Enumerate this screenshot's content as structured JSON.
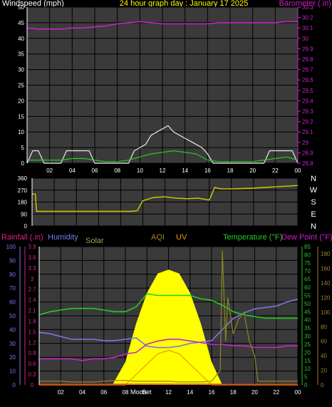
{
  "chart_data": [
    {
      "type": "line",
      "title": "24 hour graph day : January 17 2025",
      "left_axis_label": "Windspeed (mph)",
      "right_axis_label": "Barometer (.in)",
      "x_tick_labels": [
        "02",
        "04",
        "06",
        "08",
        "10",
        "12",
        "14",
        "16",
        "18",
        "20",
        "22",
        "00"
      ],
      "left_ticks": [
        0,
        5,
        10,
        15,
        20,
        25,
        30,
        35,
        40,
        45,
        50
      ],
      "right_ticks": [
        "28.8",
        "28.9",
        "29",
        "29.1",
        "29.2",
        "29.3",
        "29.4",
        "29.5",
        "29.6",
        "29.7",
        "29.8",
        "29.9",
        "30",
        "30.1",
        "30.2",
        "30.3"
      ],
      "ylim_left": [
        0,
        50
      ],
      "ylim_right": [
        28.8,
        30.3
      ],
      "series": [
        {
          "color": "#cc22cc",
          "axis": "right",
          "x": [
            0,
            1,
            2,
            3,
            4,
            5,
            6,
            7,
            8,
            9,
            10,
            11,
            12,
            13,
            14,
            15,
            16,
            17,
            18,
            19,
            20,
            21,
            22,
            23,
            24
          ],
          "y": [
            30.1,
            30.09,
            30.09,
            30.09,
            30.1,
            30.1,
            30.11,
            30.12,
            30.14,
            30.15,
            30.16,
            30.15,
            30.14,
            30.14,
            30.14,
            30.14,
            30.14,
            30.15,
            30.15,
            30.15,
            30.15,
            30.15,
            30.15,
            30.16,
            30.16
          ]
        },
        {
          "color": "#e8e8e8",
          "axis": "left",
          "x": [
            0,
            0.5,
            1,
            1.5,
            2,
            3,
            3.5,
            4,
            4.5,
            5,
            5.5,
            6,
            7,
            8,
            9,
            9.5,
            10,
            10.5,
            11,
            11.5,
            12,
            12.5,
            13,
            13.5,
            14,
            14.5,
            15,
            15.5,
            16,
            16.5,
            17,
            18,
            19,
            20,
            21,
            21.5,
            22,
            22.5,
            23,
            23.5,
            24
          ],
          "y": [
            0,
            4,
            4,
            0,
            0,
            0,
            4,
            4,
            4,
            4,
            4,
            0,
            0,
            0,
            0,
            4,
            5,
            6,
            9,
            10,
            11,
            12,
            10,
            9,
            8,
            7,
            6,
            5,
            3,
            0,
            0,
            0,
            0,
            0,
            0,
            4,
            4,
            4,
            4,
            4,
            0
          ]
        },
        {
          "color": "#22cc22",
          "axis": "left",
          "x": [
            0,
            1,
            2,
            3,
            4,
            5,
            6,
            7,
            8,
            9,
            10,
            11,
            12,
            13,
            14,
            15,
            16,
            17,
            18,
            19,
            20,
            21,
            22,
            23,
            24
          ],
          "y": [
            1,
            1,
            1,
            1,
            1.5,
            1.5,
            1,
            0.5,
            0.5,
            1,
            2,
            3,
            3.5,
            4,
            3.5,
            3,
            1,
            0.5,
            0.5,
            0.5,
            0.5,
            1,
            1.5,
            2,
            1
          ]
        }
      ]
    },
    {
      "type": "line",
      "title": "",
      "left_ticks": [
        0,
        90,
        180,
        270,
        360
      ],
      "right_ticks": [
        "N",
        "W",
        "S",
        "E",
        "N"
      ],
      "ylim": [
        0,
        360
      ],
      "series": [
        {
          "color": "#cccc00",
          "x": [
            0,
            0.3,
            0.4,
            1,
            2,
            3,
            4,
            5,
            6,
            7,
            8,
            9,
            9.5,
            10,
            11,
            12,
            13,
            14,
            15,
            16,
            16.5,
            17,
            18,
            19,
            20,
            21,
            22,
            23,
            24
          ],
          "y": [
            240,
            240,
            110,
            110,
            110,
            110,
            110,
            110,
            110,
            110,
            110,
            110,
            115,
            190,
            215,
            220,
            210,
            205,
            210,
            195,
            290,
            280,
            280,
            282,
            285,
            290,
            295,
            300,
            305
          ]
        }
      ]
    },
    {
      "type": "line",
      "title": "",
      "legend": [
        "Rainfall (.in)",
        "Humidity",
        "Solar",
        "AQI",
        "UV",
        "Temperature (°F)",
        "Dew Point (°F)"
      ],
      "rain_ticks": [
        "0",
        "0.3",
        "0.6",
        "0.9",
        "1.2",
        "1.5",
        "1.8",
        "2.1",
        "2.4",
        "2.7",
        "3",
        "3.3",
        "3.6",
        "3.9"
      ],
      "humidity_ticks": [
        0,
        10,
        20,
        30,
        40,
        50,
        60,
        70,
        80,
        90,
        100
      ],
      "temp_ticks": [
        0,
        5,
        10,
        15,
        20,
        25,
        30,
        35,
        40,
        45,
        50,
        55,
        60,
        65,
        70,
        75,
        80,
        85
      ],
      "aqi_ticks": [
        0,
        20,
        40,
        60,
        80,
        100,
        120,
        140,
        160,
        180
      ],
      "x_tick_labels": [
        "02",
        "04",
        "06",
        "08",
        "",
        "12",
        "14",
        "16",
        "18",
        "20",
        "22",
        "00"
      ],
      "moon_labels": [
        "Moon",
        "Set"
      ],
      "ylim_humidity": [
        0,
        100
      ],
      "ylim_temp": [
        0,
        85
      ],
      "ylim_aqi": [
        0,
        190
      ],
      "series": [
        {
          "name": "Humidity",
          "color": "#7777ee",
          "x": [
            0,
            1,
            2,
            3,
            4,
            5,
            6,
            7,
            8,
            9,
            10,
            11,
            12,
            13,
            14,
            15,
            16,
            17,
            18,
            19,
            20,
            21,
            22,
            23,
            24
          ],
          "y": [
            38,
            37,
            35,
            33,
            33,
            33,
            32,
            32,
            33,
            34,
            28,
            27,
            27,
            28,
            30,
            31,
            32,
            40,
            48,
            52,
            55,
            56,
            57,
            60,
            62
          ]
        },
        {
          "name": "Temperature (°F)",
          "color": "#22cc22",
          "x": [
            0,
            1,
            2,
            3,
            4,
            5,
            6,
            7,
            8,
            9,
            10,
            11,
            12,
            13,
            14,
            15,
            16,
            17,
            18,
            19,
            20,
            21,
            22,
            23,
            24
          ],
          "y": [
            43,
            45,
            46,
            47,
            47,
            47,
            46,
            45,
            45,
            48,
            56,
            55,
            55,
            55,
            55,
            53,
            52,
            49,
            45,
            43,
            42,
            41,
            41,
            41,
            41
          ]
        },
        {
          "name": "Dew Point (°F)",
          "color": "#cc22cc",
          "x": [
            0,
            1,
            2,
            3,
            4,
            5,
            6,
            7,
            8,
            9,
            10,
            11,
            12,
            13,
            14,
            15,
            16,
            17,
            18,
            19,
            20,
            21,
            22,
            23,
            24
          ],
          "y": [
            16,
            16,
            16,
            16,
            15,
            16,
            16,
            17,
            19,
            20,
            25,
            27,
            28,
            28,
            27,
            26,
            25,
            25,
            24,
            24,
            23,
            23,
            23,
            24,
            24
          ]
        },
        {
          "name": "Solar",
          "color": "#ffff00",
          "x": [
            0,
            6.8,
            8,
            9,
            10,
            11,
            12,
            13,
            14,
            15,
            16,
            17,
            17.2,
            24
          ],
          "y": [
            0,
            0,
            30,
            80,
            120,
            145,
            150,
            145,
            120,
            80,
            30,
            0,
            0,
            0
          ]
        },
        {
          "name": "AQI",
          "color": "#888820",
          "x": [
            0,
            1,
            2,
            3,
            4,
            5,
            6,
            7,
            8,
            9,
            10,
            11,
            12,
            13,
            14,
            15,
            16,
            16.8,
            17,
            17.3,
            17.5,
            18,
            18.5,
            19,
            19.5,
            20,
            20.3,
            21,
            22,
            23,
            24
          ],
          "y": [
            5,
            5,
            5,
            4,
            4,
            4,
            5,
            6,
            6,
            5,
            5,
            5,
            5,
            4,
            4,
            4,
            5,
            20,
            185,
            60,
            120,
            70,
            90,
            100,
            60,
            40,
            5,
            5,
            5,
            5,
            5
          ]
        },
        {
          "name": "UV",
          "color": "#ee9900",
          "x": [
            0,
            8,
            9,
            10,
            11,
            12,
            13,
            14,
            15,
            16,
            24
          ],
          "y": [
            0,
            0,
            3,
            6,
            9,
            10,
            9,
            6,
            3,
            0,
            0
          ]
        },
        {
          "name": "Rainfall (.in)",
          "color": "#dd2222",
          "x": [
            0,
            24
          ],
          "y": [
            0,
            0
          ]
        }
      ]
    }
  ],
  "colors": {
    "white": "#ffffff",
    "pink": "#e02090",
    "blue": "#7777ee",
    "tan": "#aa9955",
    "aqi": "#a08030",
    "uv": "#ee9900",
    "green": "#22cc22",
    "magenta": "#cc22cc",
    "yellow": "#cccc00"
  }
}
